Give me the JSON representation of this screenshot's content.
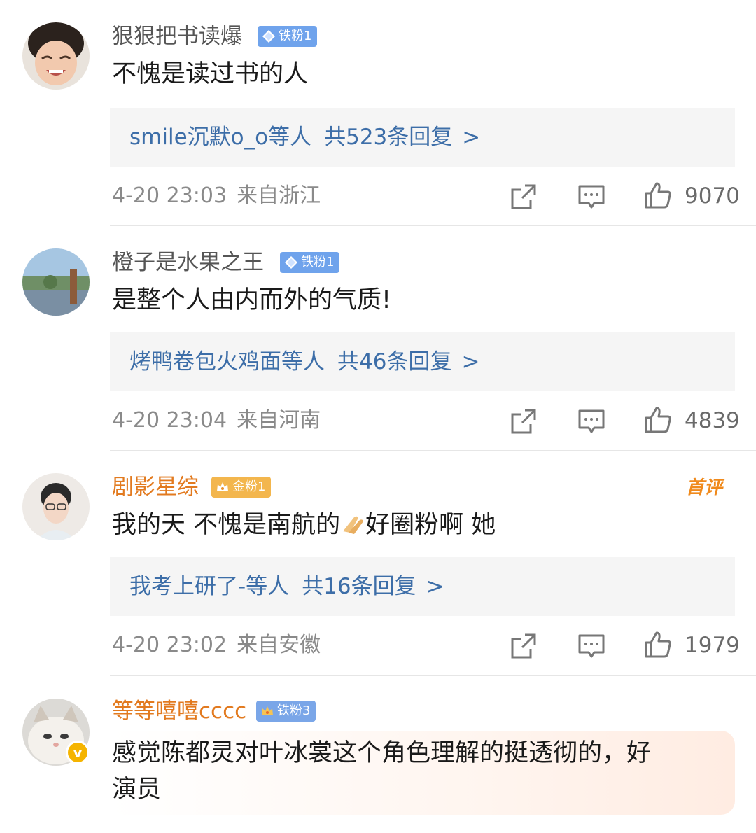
{
  "comments": [
    {
      "username": "狠狠把书读爆",
      "badge": "铁粉1",
      "content": "不愧是读过书的人",
      "reply_users": "smile沉默o_o等人",
      "reply_count": "共523条回复",
      "reply_chevron": ">",
      "time": "4-20 23:03",
      "location": "来自浙江",
      "likes": "9070"
    },
    {
      "username": "橙子是水果之王",
      "badge": "铁粉1",
      "content": "是整个人由内而外的气质!",
      "reply_users": "烤鸭卷包火鸡面等人",
      "reply_count": "共46条回复",
      "reply_chevron": ">",
      "time": "4-20 23:04",
      "location": "来自河南",
      "likes": "4839"
    },
    {
      "username": "剧影星综",
      "badge": "金粉1",
      "first_tag": "首评",
      "content_a": "我的天 不愧是南航的",
      "content_b": "好圈粉啊 她",
      "reply_users": "我考上研了-等人",
      "reply_count": "共16条回复",
      "reply_chevron": ">",
      "time": "4-20 23:02",
      "location": "来自安徽",
      "likes": "1979"
    },
    {
      "username": "等等嘻嘻cccc",
      "badge": "铁粉3",
      "verified_mark": "v",
      "content_line1": "感觉陈都灵对叶冰裳这个角色理解的挺透彻的，好",
      "content_line2": "演员"
    }
  ],
  "colors": {
    "link": "#3d6ea8",
    "orange_name": "#e27a1f",
    "iron_badge": "#6fa3ec",
    "gold_badge": "#f3b64d",
    "reply_bg": "#f5f5f5"
  },
  "icons": [
    "share-icon",
    "comment-icon",
    "like-icon",
    "diamond-icon",
    "crown-icon",
    "clap-emoji",
    "verified-icon"
  ]
}
